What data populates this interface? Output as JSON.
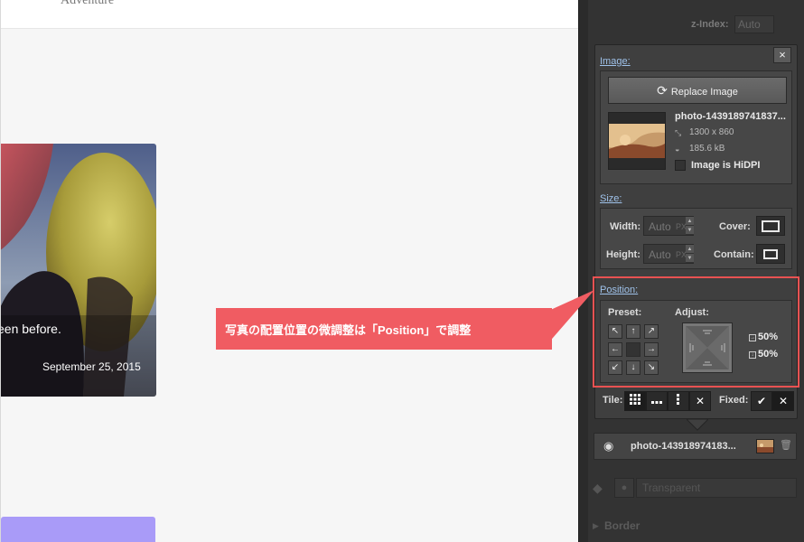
{
  "site": {
    "nav_text": "Adventure",
    "card_text": "een before.",
    "card_date": "September 25, 2015"
  },
  "sidebar": {
    "zindex_label": "z-Index:",
    "zindex_value": "Auto",
    "close_label": "×",
    "image": {
      "section_label": "Image:",
      "replace_label": "Replace Image",
      "file_name": "photo-1439189741837...",
      "dimensions": "1300 x 860",
      "file_size": "185.6 kB",
      "hidpi_label": "Image is HiDPI"
    },
    "size": {
      "section_label": "Size:",
      "width_label": "Width:",
      "width_value": "Auto",
      "height_label": "Height:",
      "height_value": "Auto",
      "unit": "PX",
      "cover_label": "Cover:",
      "contain_label": "Contain:"
    },
    "position": {
      "section_label": "Position:",
      "preset_label": "Preset:",
      "adjust_label": "Adjust:",
      "x_percent": "50%",
      "y_percent": "50%",
      "preset_arrows": [
        "↖",
        "↑",
        "↗",
        "←",
        "",
        "→",
        "↙",
        "↓",
        "↘"
      ]
    },
    "tile": {
      "label": "Tile:",
      "options": [
        "grid",
        "horizontal",
        "vertical",
        "none"
      ]
    },
    "fixed": {
      "label": "Fixed:"
    },
    "layer": {
      "name": "photo-143918974183..."
    },
    "background_color": {
      "value": "Transparent"
    },
    "border": {
      "label": "Border"
    }
  },
  "annotation": {
    "text": "写真の配置位置の微調整は「Position」で調整"
  },
  "colors": {
    "callout": "#f05c62",
    "highlight": "#e95252",
    "panel_bg": "#3f3f3f",
    "sidebar_bg": "#333333",
    "link_blue": "#9fc2ea",
    "purple_block": "#a99bf8"
  }
}
